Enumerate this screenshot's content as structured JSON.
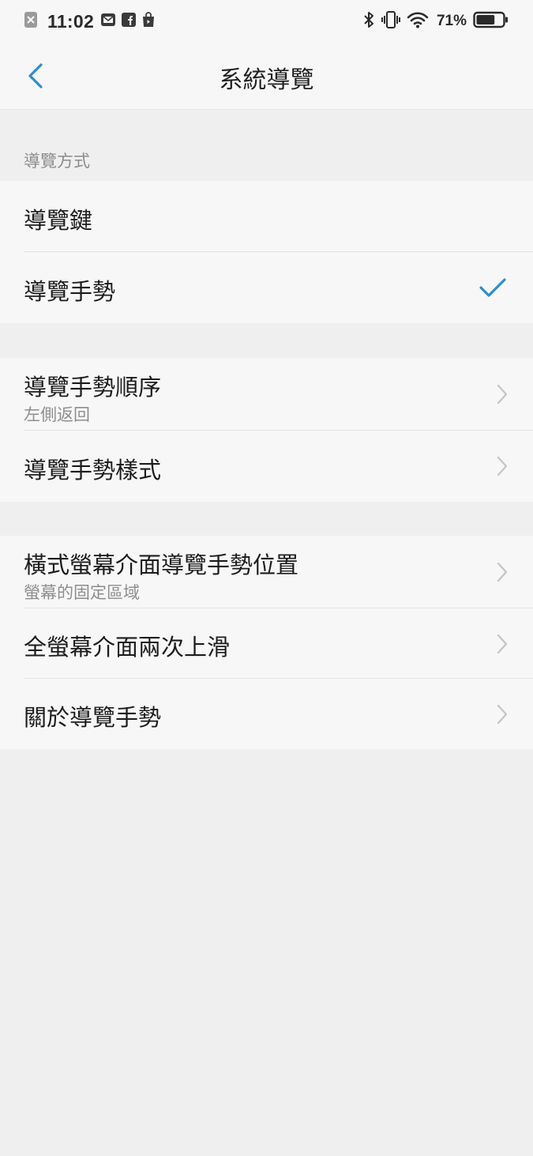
{
  "status_bar": {
    "time": "11:02",
    "battery_percent": "71%",
    "battery_level": 0.71,
    "left_icons": [
      "close-notification-icon",
      "mail-icon",
      "facebook-icon",
      "shopping-bag-icon"
    ],
    "right_icons": [
      "bluetooth-icon",
      "vibrate-icon",
      "wifi-icon",
      "battery-icon"
    ]
  },
  "header": {
    "title": "系統導覽",
    "back_icon": "chevron-left-icon"
  },
  "colors": {
    "accent": "#2a8fd0",
    "background": "#efefef",
    "surface": "#f7f7f7"
  },
  "nav_mode": {
    "section_label": "導覽方式",
    "options": [
      {
        "label": "導覽鍵",
        "selected": false
      },
      {
        "label": "導覽手勢",
        "selected": true
      }
    ]
  },
  "gesture_settings": [
    {
      "label": "導覽手勢順序",
      "subtitle": "左側返回"
    },
    {
      "label": "導覽手勢樣式"
    }
  ],
  "other_settings": [
    {
      "label": "橫式螢幕介面導覽手勢位置",
      "subtitle": "螢幕的固定區域"
    },
    {
      "label": "全螢幕介面兩次上滑"
    },
    {
      "label": "關於導覽手勢"
    }
  ]
}
